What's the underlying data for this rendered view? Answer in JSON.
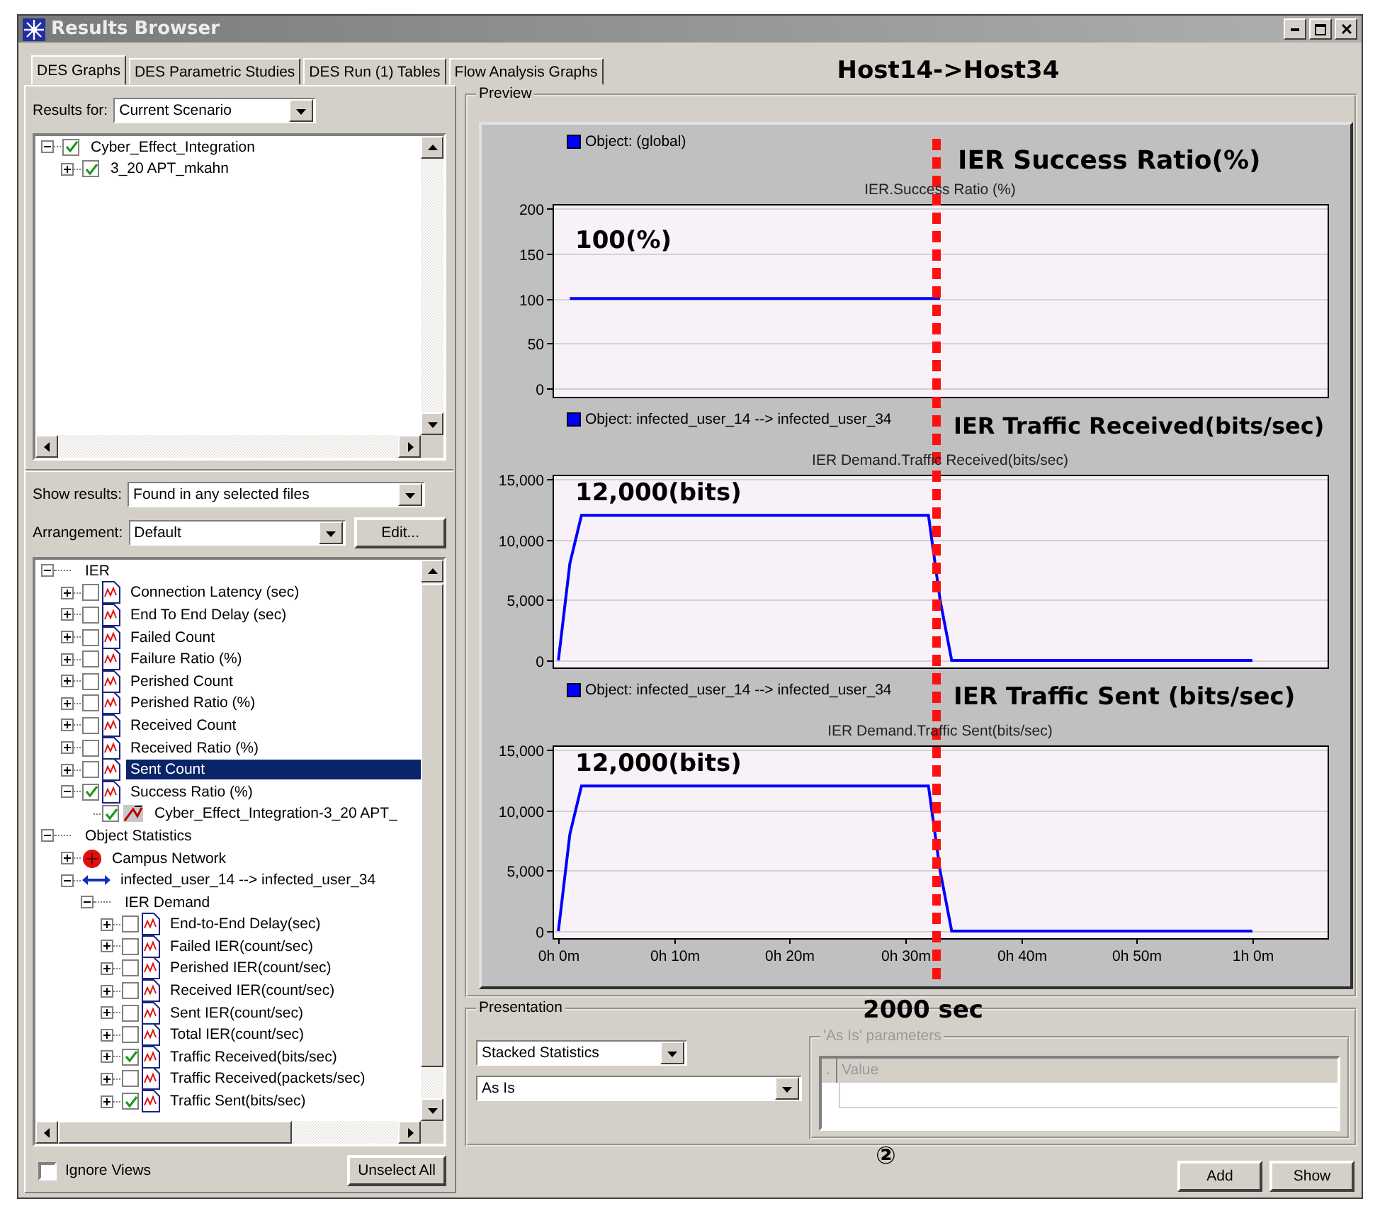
{
  "window": {
    "title": "Results Browser"
  },
  "tabs": [
    {
      "label": "DES Graphs",
      "selected": true
    },
    {
      "label": "DES Parametric Studies",
      "selected": false
    },
    {
      "label": "DES Run (1) Tables",
      "selected": false
    },
    {
      "label": "Flow Analysis Graphs",
      "selected": false
    }
  ],
  "heading": "Host14->Host34",
  "results_for": {
    "label": "Results for:",
    "value": "Current Scenario"
  },
  "scenario_tree": {
    "items": [
      {
        "label": "Cyber_Effect_Integration",
        "kind": "scenario",
        "expanded": true,
        "checked": true,
        "selected": false,
        "children": [
          {
            "label": "3_20 APT_mkahn",
            "kind": "scenario",
            "expanded": false,
            "checked": true,
            "selected": false
          }
        ]
      }
    ]
  },
  "show_results": {
    "label": "Show results:",
    "value": "Found in any selected files"
  },
  "arrangement": {
    "label": "Arrangement:",
    "value": "Default",
    "button": "Edit..."
  },
  "statistics_tree": {
    "items": [
      {
        "label": "IER",
        "kind": "group",
        "expanded": true,
        "selected": false,
        "children": [
          {
            "label": "Connection Latency (sec)",
            "kind": "statistic",
            "expanded": false,
            "checked": false,
            "selected": false
          },
          {
            "label": "End To End Delay (sec)",
            "kind": "statistic",
            "expanded": false,
            "checked": false,
            "selected": false
          },
          {
            "label": "Failed Count",
            "kind": "statistic",
            "expanded": false,
            "checked": false,
            "selected": false
          },
          {
            "label": "Failure Ratio (%)",
            "kind": "statistic",
            "expanded": false,
            "checked": false,
            "selected": false
          },
          {
            "label": "Perished Count",
            "kind": "statistic",
            "expanded": false,
            "checked": false,
            "selected": false
          },
          {
            "label": "Perished Ratio (%)",
            "kind": "statistic",
            "expanded": false,
            "checked": false,
            "selected": false
          },
          {
            "label": "Received Count",
            "kind": "statistic",
            "expanded": false,
            "checked": false,
            "selected": false
          },
          {
            "label": "Received Ratio (%)",
            "kind": "statistic",
            "expanded": false,
            "checked": false,
            "selected": false
          },
          {
            "label": "Sent Count",
            "kind": "statistic",
            "expanded": false,
            "checked": false,
            "selected": true
          },
          {
            "label": "Success Ratio (%)",
            "kind": "statistic",
            "expanded": true,
            "checked": true,
            "selected": false,
            "children": [
              {
                "label": "Cyber_Effect_Integration-3_20 APT_",
                "kind": "result",
                "checked": true,
                "selected": false
              }
            ]
          }
        ]
      },
      {
        "label": "Object Statistics",
        "kind": "group",
        "expanded": true,
        "selected": false,
        "children": [
          {
            "label": "Campus Network",
            "kind": "network",
            "expanded": false,
            "selected": false
          },
          {
            "label": "infected_user_14 --> infected_user_34",
            "kind": "link",
            "expanded": true,
            "selected": false,
            "children": [
              {
                "label": "IER Demand",
                "kind": "group",
                "expanded": true,
                "selected": false,
                "children": [
                  {
                    "label": "End-to-End Delay(sec)",
                    "kind": "statistic",
                    "expanded": false,
                    "checked": false,
                    "selected": false
                  },
                  {
                    "label": "Failed IER(count/sec)",
                    "kind": "statistic",
                    "expanded": false,
                    "checked": false,
                    "selected": false
                  },
                  {
                    "label": "Perished IER(count/sec)",
                    "kind": "statistic",
                    "expanded": false,
                    "checked": false,
                    "selected": false
                  },
                  {
                    "label": "Received IER(count/sec)",
                    "kind": "statistic",
                    "expanded": false,
                    "checked": false,
                    "selected": false
                  },
                  {
                    "label": "Sent IER(count/sec)",
                    "kind": "statistic",
                    "expanded": false,
                    "checked": false,
                    "selected": false
                  },
                  {
                    "label": "Total IER(count/sec)",
                    "kind": "statistic",
                    "expanded": false,
                    "checked": false,
                    "selected": false
                  },
                  {
                    "label": "Traffic Received(bits/sec)",
                    "kind": "statistic",
                    "expanded": false,
                    "checked": true,
                    "selected": false
                  },
                  {
                    "label": "Traffic Received(packets/sec)",
                    "kind": "statistic",
                    "expanded": false,
                    "checked": false,
                    "selected": false
                  },
                  {
                    "label": "Traffic Sent(bits/sec)",
                    "kind": "statistic",
                    "expanded": false,
                    "checked": true,
                    "selected": false
                  }
                ]
              }
            ]
          }
        ]
      }
    ]
  },
  "ignore_views": {
    "label": "Ignore Views",
    "checked": false
  },
  "unselect_button": "Unselect All",
  "preview": {
    "title": "Preview",
    "marker_label": "2000 sec",
    "charts": [
      {
        "callout": "IER Success Ratio(%)",
        "note": "100(%)",
        "chart_data": {
          "type": "line",
          "title": "IER.Success Ratio (%)",
          "categories": [
            null,
            null,
            null,
            null,
            null,
            null,
            null,
            null,
            null,
            null,
            null,
            null,
            null,
            null,
            null,
            null,
            null,
            null,
            null,
            null,
            null,
            null,
            null,
            null,
            null,
            null,
            null,
            null,
            null,
            null,
            null,
            null,
            null,
            null,
            null,
            null,
            null,
            null,
            null,
            null,
            null,
            null,
            null,
            null,
            null,
            null,
            null,
            null,
            null,
            null,
            null,
            null,
            null,
            null,
            null,
            null,
            null,
            null,
            null,
            null,
            null,
            null,
            null,
            null,
            null,
            null,
            null
          ],
          "series": [
            {
              "name": "Object: (global)",
              "color": "#0000ff",
              "values": [
                null,
                100,
                100,
                100,
                100,
                100,
                100,
                100,
                100,
                100,
                100,
                100,
                100,
                100,
                100,
                100,
                100,
                100,
                100,
                100,
                100,
                100,
                100,
                100,
                100,
                100,
                100,
                100,
                100,
                100,
                100,
                100,
                100,
                100,
                null,
                null,
                null,
                null,
                null,
                null,
                null,
                null,
                null,
                null,
                null,
                null,
                null,
                null,
                null,
                null,
                null,
                null,
                null,
                null,
                null,
                null,
                null,
                null,
                null,
                null,
                null,
                null,
                null,
                null,
                null,
                null,
                null
              ]
            }
          ],
          "ylim": [
            -9,
            204.7
          ],
          "yticks": [
            0,
            50,
            100,
            150,
            200
          ],
          "grid": true
        }
      },
      {
        "callout": "IER Traffic Received(bits/sec)",
        "note": "12,000(bits)",
        "chart_data": {
          "type": "line",
          "title": "IER Demand.Traffic Received(bits/sec)",
          "categories": [
            null,
            null,
            null,
            null,
            null,
            null,
            null,
            null,
            null,
            null,
            null,
            null,
            null,
            null,
            null,
            null,
            null,
            null,
            null,
            null,
            null,
            null,
            null,
            null,
            null,
            null,
            null,
            null,
            null,
            null,
            null,
            null,
            null,
            null,
            null,
            null,
            null,
            null,
            null,
            null,
            null,
            null,
            null,
            null,
            null,
            null,
            null,
            null,
            null,
            null,
            null,
            null,
            null,
            null,
            null,
            null,
            null,
            null,
            null,
            null,
            null,
            null,
            null,
            null,
            null,
            null,
            null
          ],
          "series": [
            {
              "name": "Object: infected_user_14 --> infected_user_34",
              "color": "#0000ff",
              "values": [
                0,
                8000,
                12000,
                12000,
                12000,
                12000,
                12000,
                12000,
                12000,
                12000,
                12000,
                12000,
                12000,
                12000,
                12000,
                12000,
                12000,
                12000,
                12000,
                12000,
                12000,
                12000,
                12000,
                12000,
                12000,
                12000,
                12000,
                12000,
                12000,
                12000,
                12000,
                12000,
                12000,
                5000,
                0,
                0,
                0,
                0,
                0,
                0,
                0,
                0,
                0,
                0,
                0,
                0,
                0,
                0,
                0,
                0,
                0,
                0,
                0,
                0,
                0,
                0,
                0,
                0,
                0,
                0,
                0,
                null,
                null,
                null,
                null,
                null,
                null
              ]
            }
          ],
          "ylim": [
            -585,
            15350
          ],
          "yticks": [
            {
              "value": 0,
              "label": "0"
            },
            {
              "value": 5000,
              "label": "5,000"
            },
            {
              "value": 10000,
              "label": "10,000"
            },
            {
              "value": 15000,
              "label": "15,000"
            }
          ],
          "grid": true
        }
      },
      {
        "callout": "IER Traffic Sent (bits/sec)",
        "note": "12,000(bits)",
        "chart_data": {
          "type": "line",
          "title": "IER Demand.Traffic Sent(bits/sec)",
          "categories": [
            "0h 0m",
            null,
            null,
            null,
            null,
            null,
            null,
            null,
            null,
            null,
            "0h 10m",
            null,
            null,
            null,
            null,
            null,
            null,
            null,
            null,
            null,
            "0h 20m",
            null,
            null,
            null,
            null,
            null,
            null,
            null,
            null,
            null,
            "0h 30m",
            null,
            null,
            null,
            null,
            null,
            null,
            null,
            null,
            null,
            "0h 40m",
            null,
            null,
            null,
            null,
            null,
            null,
            null,
            null,
            null,
            "0h 50m",
            null,
            null,
            null,
            null,
            null,
            null,
            null,
            null,
            null,
            "1h 0m",
            null,
            null,
            null,
            null,
            null,
            null
          ],
          "series": [
            {
              "name": "Object: infected_user_14 --> infected_user_34",
              "color": "#0000ff",
              "values": [
                0,
                8000,
                12000,
                12000,
                12000,
                12000,
                12000,
                12000,
                12000,
                12000,
                12000,
                12000,
                12000,
                12000,
                12000,
                12000,
                12000,
                12000,
                12000,
                12000,
                12000,
                12000,
                12000,
                12000,
                12000,
                12000,
                12000,
                12000,
                12000,
                12000,
                12000,
                12000,
                12000,
                5000,
                0,
                0,
                0,
                0,
                0,
                0,
                0,
                0,
                0,
                0,
                0,
                0,
                0,
                0,
                0,
                0,
                0,
                0,
                0,
                0,
                0,
                0,
                0,
                0,
                0,
                0,
                0,
                null,
                null,
                null,
                null,
                null,
                null
              ]
            }
          ],
          "ylim": [
            -585,
            15350
          ],
          "yticks": [
            {
              "value": 0,
              "label": "0"
            },
            {
              "value": 5000,
              "label": "5,000"
            },
            {
              "value": 10000,
              "label": "10,000"
            },
            {
              "value": 15000,
              "label": "15,000"
            }
          ],
          "grid": true
        }
      }
    ]
  },
  "presentation": {
    "title": "Presentation",
    "selects": [
      "Stacked Statistics",
      "As Is"
    ],
    "parameters": {
      "title": "'As Is' parameters",
      "disabled": true,
      "columns": [
        ".",
        "Value"
      ]
    }
  },
  "step_mark": "②",
  "buttons": [
    "Add",
    "Show"
  ]
}
